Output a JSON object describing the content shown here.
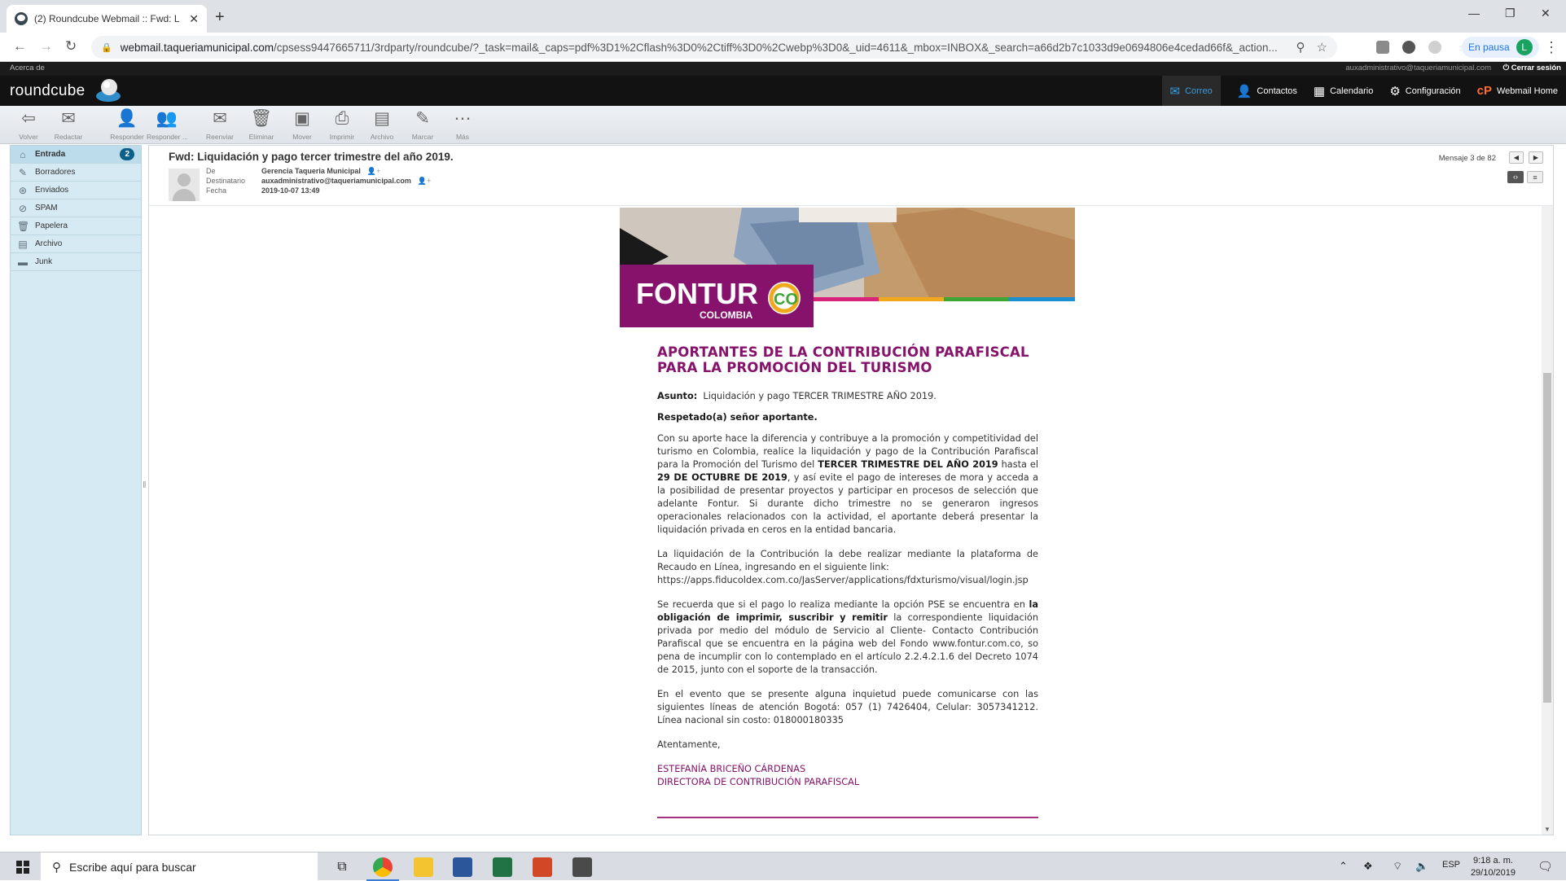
{
  "browser": {
    "tab_title": "(2) Roundcube Webmail :: Fwd: L",
    "url_host": "webmail.taqueriamunicipal.com",
    "url_path": "/cpsess9447665711/3rdparty/roundcube/?_task=mail&_caps=pdf%3D1%2Cflash%3D0%2Ctiff%3D0%2Cwebp%3D0&_uid=4611&_mbox=INBOX&_search=a66d2b7c1033d9e0694806e4cedad66f&_action...",
    "profile_status": "En pausa",
    "profile_initial": "L"
  },
  "roundcube": {
    "about": "Acerca de",
    "user_email": "auxadministrativo@taqueriamunicipal.com",
    "logout": "Cerrar sesión",
    "logo": "roundcube",
    "nav": {
      "mail": "Correo",
      "contacts": "Contactos",
      "calendar": "Calendario",
      "settings": "Configuración",
      "webmail_home": "Webmail Home"
    },
    "toolbar": {
      "back": "Volver",
      "compose": "Redactar",
      "reply": "Responder",
      "reply_all": "Responder ...",
      "forward": "Reenviar",
      "delete": "Eliminar",
      "move": "Mover",
      "print": "Imprimir",
      "archive": "Archivo",
      "mark": "Marcar",
      "more": "Más"
    },
    "folders": [
      {
        "name": "Entrada",
        "count": "2",
        "icon": "inbox-icon"
      },
      {
        "name": "Borradores",
        "icon": "pencil-icon"
      },
      {
        "name": "Enviados",
        "icon": "sent-icon"
      },
      {
        "name": "SPAM",
        "icon": "spam-icon"
      },
      {
        "name": "Papelera",
        "icon": "trash-icon"
      },
      {
        "name": "Archivo",
        "icon": "archive-icon"
      },
      {
        "name": "Junk",
        "icon": "folder-icon"
      }
    ]
  },
  "message": {
    "subject": "Fwd: Liquidación y pago tercer trimestre del año 2019.",
    "from_label": "De",
    "from": "Gerencia Taqueria Municipal",
    "to_label": "Destinatario",
    "to": "auxadministrativo@taqueriamunicipal.com",
    "date_label": "Fecha",
    "date": "2019-10-07 13:49",
    "counter": "Mensaje 3 de 82"
  },
  "email": {
    "brand": "FONTUR",
    "brand_sub": "COLOMBIA",
    "brand_co": "CO",
    "heading_1": "APORTANTES DE LA CONTRIBUCIÓN PARAFISCAL",
    "heading_2": "PARA LA PROMOCIÓN DEL TURISMO",
    "asunto_label": "Asunto:",
    "asunto_value": "Liquidación y pago TERCER TRIMESTRE AÑO 2019.",
    "greeting": "Respetado(a) señor aportante.",
    "p1_a": "Con su aporte hace la diferencia y contribuye a la promoción y competitividad del turismo en Colombia, realice la liquidación y pago de la Contribución Parafiscal para la Promoción del Turismo del ",
    "p1_b": "TERCER TRIMESTRE DEL AÑO 2019",
    "p1_c": " hasta el ",
    "p1_d": "29 DE OCTUBRE DE 2019",
    "p1_e": ", y así evite el pago de intereses de mora y acceda a la posibilidad de presentar proyectos y participar en procesos de selección que adelante Fontur. Si durante dicho trimestre no se generaron ingresos operacionales relacionados con la actividad, el aportante deberá presentar la liquidación privada en ceros en la entidad bancaria.",
    "p2": "La liquidación de la Contribución la debe realizar mediante la plataforma de Recaudo en Línea, ingresando en el siguiente link:",
    "p2_link": "https://apps.fiducoldex.com.co/JasServer/applications/fdxturismo/visual/login.jsp",
    "p3_a": "Se recuerda que si el pago lo realiza mediante la opción PSE se encuentra en ",
    "p3_b": "la obligación de imprimir, suscribir y remitir",
    "p3_c": " la correspondiente liquidación privada por medio del módulo de Servicio al Cliente- Contacto Contribución Parafiscal que se encuentra en la página web del Fondo www.fontur.com.co, so pena de incumplir con lo contemplado en el artículo 2.2.4.2.1.6 del Decreto 1074 de 2015, junto con el soporte de la transacción.",
    "p4": "En el evento que se presente alguna inquietud puede comunicarse con las siguientes líneas de atención Bogotá: 057 (1) 7426404, Celular: 3057341212. Línea nacional sin costo: 018000180335",
    "closing": "Atentamente,",
    "sig_name": "ESTEFANÍA BRICEÑO CÁRDENAS",
    "sig_title": "DIRECTORA DE CONTRIBUCIÓN PARAFISCAL"
  },
  "taskbar": {
    "search_placeholder": "Escribe aquí para buscar",
    "lang": "ESP",
    "time": "9:18 a. m.",
    "date": "29/10/2019"
  },
  "colors": {
    "fontur_purple": "#86126b",
    "roundcube_active": "#3a9bdc",
    "folder_pane": "#d6eaf3"
  }
}
